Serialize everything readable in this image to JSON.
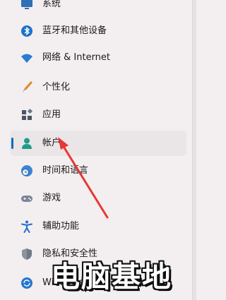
{
  "nav": {
    "items": [
      {
        "label": "系统",
        "icon": "monitor-icon"
      },
      {
        "label": "蓝牙和其他设备",
        "icon": "bluetooth-icon"
      },
      {
        "label": "网络 & Internet",
        "icon": "wifi-icon"
      },
      {
        "label": "个性化",
        "icon": "brush-icon"
      },
      {
        "label": "应用",
        "icon": "apps-icon"
      },
      {
        "label": "帐户",
        "icon": "account-icon",
        "selected": true
      },
      {
        "label": "时间和语言",
        "icon": "globe-clock-icon"
      },
      {
        "label": "游戏",
        "icon": "gamepad-icon"
      },
      {
        "label": "辅助功能",
        "icon": "accessibility-icon"
      },
      {
        "label": "隐私和安全性",
        "icon": "shield-icon"
      },
      {
        "label": "Windows 更新",
        "icon": "update-icon"
      }
    ]
  },
  "watermark": {
    "text": "电脑基地"
  },
  "colors": {
    "accent": "#0f6cbd",
    "arrow": "#e53935",
    "background": "#f3eef0"
  }
}
